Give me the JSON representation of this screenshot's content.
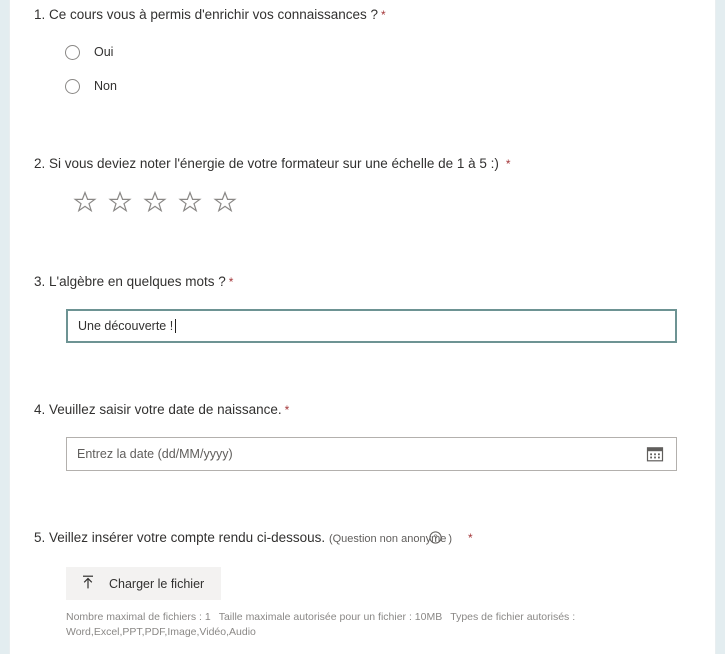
{
  "theme": {
    "required_asterisk_color": "#a4373a",
    "focused_border_color": "#6d9393",
    "default_border_color": "#b3b0ad",
    "text_color": "#323130",
    "muted_text_color": "#605e5c",
    "edge_strip_color": "#e3edf0",
    "button_bg_color": "#f3f2f1"
  },
  "form": {
    "questions": [
      {
        "number": "1.",
        "text": "Ce cours vous à permis d'enrichir vos connaissances ?",
        "required_marker": "*",
        "type": "choice",
        "options": [
          {
            "label": "Oui",
            "selected": false
          },
          {
            "label": "Non",
            "selected": false
          }
        ]
      },
      {
        "number": "2.",
        "text": "Si vous deviez noter l'énergie de votre formateur sur une échelle de 1 à 5 :)",
        "required_marker": "*",
        "type": "rating",
        "star_count": 5,
        "rating_value": 0
      },
      {
        "number": "3.",
        "text": "L'algèbre en quelques mots ?",
        "required_marker": "*",
        "type": "text",
        "value": "Une découverte !",
        "placeholder": "",
        "focused": true
      },
      {
        "number": "4.",
        "text": "Veuillez saisir votre date de naissance.",
        "required_marker": "*",
        "type": "date",
        "value": "",
        "placeholder": "Entrez la date (dd/MM/yyyy)",
        "calendar_icon": "calendar-icon"
      },
      {
        "number": "5.",
        "text": "Veillez insérer votre compte rendu ci-dessous.",
        "subnote_prefix": "(Question non anonyme",
        "subnote_suffix": ")",
        "help_icon": "help-circle-icon",
        "required_marker": "*",
        "type": "file",
        "upload_button_label": "Charger le fichier",
        "upload_icon": "upload-arrow-icon",
        "constraints_line1": "Nombre maximal de fichiers : 1",
        "constraints_line2": "Taille maximale autorisée pour un fichier : 10MB",
        "constraints_line3": "Types de fichier autorisés :",
        "constraints_line4": "Word,Excel,PPT,PDF,Image,Vidéo,Audio"
      }
    ]
  }
}
